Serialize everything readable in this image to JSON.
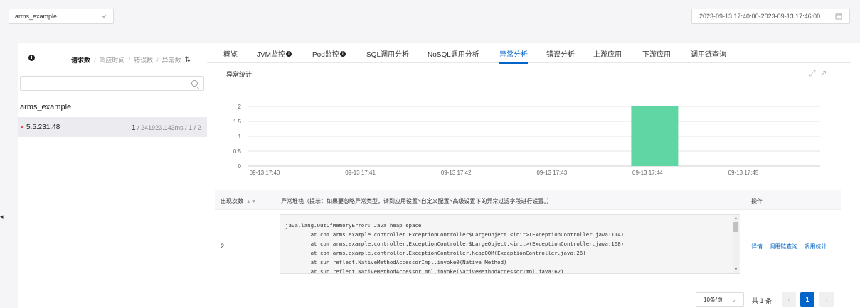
{
  "app_select": {
    "value": "arms_example"
  },
  "time_range": {
    "value": "2023-09-13 17:40:00-2023-09-13 17:46:00"
  },
  "left_panel": {
    "sort_options": [
      "请求数",
      "响应时间",
      "错误数",
      "异常数"
    ],
    "search": {
      "value": "",
      "placeholder": ""
    },
    "group_name": "arms_example",
    "instances": [
      {
        "ip": "5.5.231.48",
        "requests": "1",
        "rest": " / 241923.143ms / 1 / 2"
      }
    ]
  },
  "tabs": [
    {
      "label": "概览",
      "info": false
    },
    {
      "label": "JVM监控",
      "info": true
    },
    {
      "label": "Pod监控",
      "info": true
    },
    {
      "label": "SQL调用分析",
      "info": false
    },
    {
      "label": "NoSQL调用分析",
      "info": false
    },
    {
      "label": "异常分析",
      "info": false,
      "active": true
    },
    {
      "label": "错误分析",
      "info": false
    },
    {
      "label": "上游应用",
      "info": false
    },
    {
      "label": "下游应用",
      "info": false
    },
    {
      "label": "调用链查询",
      "info": false
    }
  ],
  "chart_section": {
    "title": "异常统计"
  },
  "chart_data": {
    "type": "bar",
    "title": "异常统计",
    "x_ticks": [
      "09-13 17:40",
      "09-13 17:41",
      "09-13 17:42",
      "09-13 17:43",
      "09-13 17:44",
      "09-13 17:45"
    ],
    "y_ticks": [
      "0",
      "0.5",
      "1",
      "1.5",
      "2"
    ],
    "ylim": [
      0,
      2
    ],
    "grid": true,
    "series": [
      {
        "points": [
          {
            "x": "09-13 17:44",
            "y": 2
          }
        ]
      }
    ],
    "bar_color": "#5fd6a4"
  },
  "table": {
    "headers": {
      "count": "出现次数",
      "stack": "异常堆栈（提示：如果要忽略异常类型，请到应用设置>自定义配置>高级设置下的异常过滤字段进行设置。）",
      "ops": "操作"
    },
    "rows": [
      {
        "count": "2",
        "stack": "java.lang.OutOfMemoryError: Java heap space\n        at com.arms.example.controller.ExceptionController$LargeObject.<init>(ExceptionController.java:114)\n        at com.arms.example.controller.ExceptionController$LargeObject.<init>(ExceptionController.java:108)\n        at com.arms.example.controller.ExceptionController.heapOOM(ExceptionController.java:26)\n        at sun.reflect.NativeMethodAccessorImpl.invoke0(Native Method)\n        at sun.reflect.NativeMethodAccessorImpl.invoke(NativeMethodAccessorImpl.java:62)",
        "ops": [
          "详情",
          "调用链查询",
          "调用统计"
        ]
      }
    ]
  },
  "pagination": {
    "page_size": "10条/页",
    "total": "共 1 条",
    "current": "1"
  }
}
